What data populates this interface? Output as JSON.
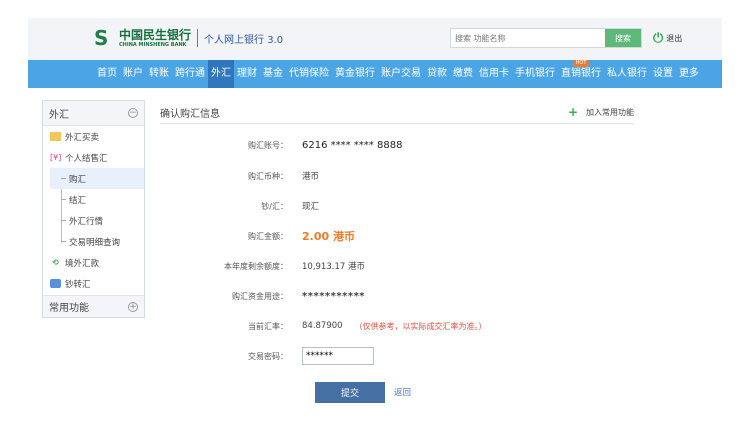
{
  "header": {
    "bank_name_cn": "中国民生银行",
    "bank_name_en": "CHINA MINSHENG BANK",
    "product": "个人网上银行 3.0",
    "search_placeholder": "搜索 功能名称",
    "search_button": "搜索",
    "logout": "退出"
  },
  "nav": {
    "items": [
      "首页",
      "账户",
      "转账",
      "跨行通",
      "外汇",
      "理财",
      "基金",
      "代销保险",
      "黄金银行",
      "账户交易",
      "贷款",
      "缴费",
      "信用卡",
      "手机银行",
      "直销银行",
      "私人银行",
      "设置",
      "更多"
    ],
    "active": "外汇",
    "hot_badge": "HOT"
  },
  "sidebar": {
    "title": "外汇",
    "items": {
      "fx_trade": "外汇买卖",
      "personal": "个人结售汇",
      "buy": "购汇",
      "sell": "结汇",
      "quotes": "外汇行情",
      "history": "交易明细查询",
      "remit": "境外汇款",
      "cash": "钞转汇"
    },
    "footer": "常用功能"
  },
  "main": {
    "title": "确认购汇信息",
    "add_fav": "加入常用功能",
    "rows": [
      {
        "label": "购汇账号：",
        "value": "6216 **** **** 8888"
      },
      {
        "label": "购汇币种：",
        "value": "港币"
      },
      {
        "label": "钞/汇：",
        "value": "现汇"
      },
      {
        "label": "购汇金额：",
        "value": "2.00 港币"
      },
      {
        "label": "本年度剩余额度：",
        "value": "10,913.17 港币"
      },
      {
        "label": "购汇资金用途：",
        "value": "***********"
      },
      {
        "label": "当前汇率：",
        "value": "84.87900",
        "note": "（仅供参考，以实际成交汇率为准。）"
      },
      {
        "label": "交易密码：",
        "value": "******"
      }
    ],
    "submit": "提交",
    "back": "返回"
  },
  "colors": {
    "nav": "#4ba5e5",
    "nav_active": "#2f77bd",
    "amount": "#f47920",
    "note": "#e34b3a",
    "submit": "#4570a4"
  }
}
